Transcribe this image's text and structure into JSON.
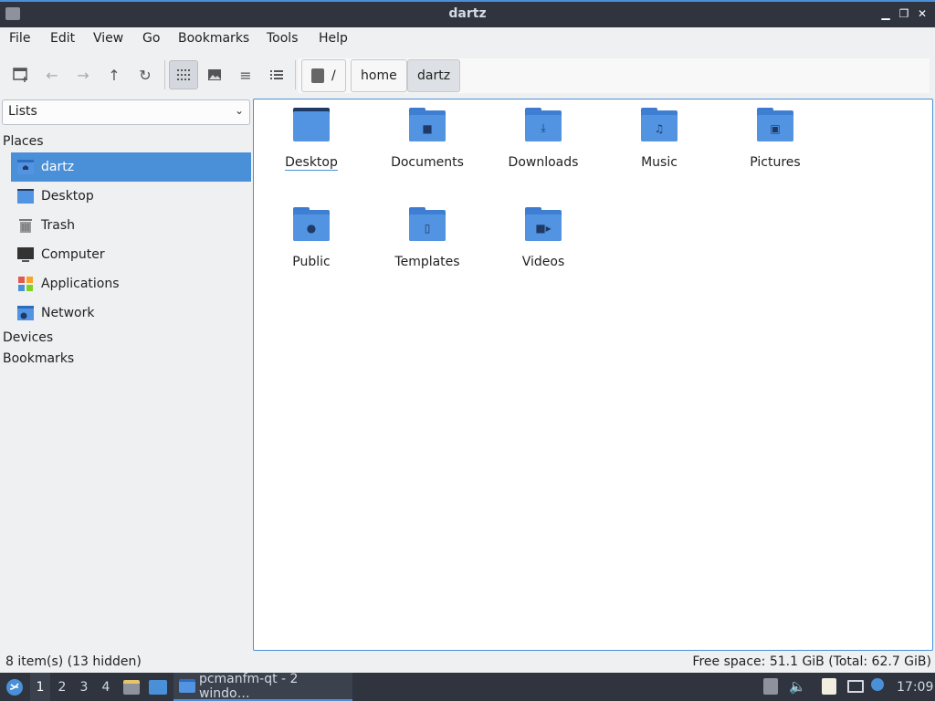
{
  "window": {
    "title": "dartz"
  },
  "menu": [
    "File",
    "Edit",
    "View",
    "Go",
    "Bookmarks",
    "Tools",
    "Help"
  ],
  "breadcrumbs": [
    "/",
    "home",
    "dartz"
  ],
  "side_panel": {
    "selector_value": "Lists",
    "places_heading": "Places",
    "places": [
      {
        "label": "dartz",
        "icon": "home-folder-icon"
      },
      {
        "label": "Desktop",
        "icon": "desktop-folder-icon"
      },
      {
        "label": "Trash",
        "icon": "trash-icon"
      },
      {
        "label": "Computer",
        "icon": "computer-icon"
      },
      {
        "label": "Applications",
        "icon": "applications-icon"
      },
      {
        "label": "Network",
        "icon": "network-icon"
      }
    ],
    "devices_heading": "Devices",
    "bookmarks_heading": "Bookmarks"
  },
  "files": [
    {
      "label": "Desktop",
      "icon": "desktop-folder-icon"
    },
    {
      "label": "Documents",
      "icon": "documents-folder-icon"
    },
    {
      "label": "Downloads",
      "icon": "downloads-folder-icon"
    },
    {
      "label": "Music",
      "icon": "music-folder-icon"
    },
    {
      "label": "Pictures",
      "icon": "pictures-folder-icon"
    },
    {
      "label": "Public",
      "icon": "public-folder-icon"
    },
    {
      "label": "Templates",
      "icon": "templates-folder-icon"
    },
    {
      "label": "Videos",
      "icon": "videos-folder-icon"
    }
  ],
  "status": {
    "left": "8 item(s) (13 hidden)",
    "right": "Free space: 51.1 GiB (Total: 62.7 GiB)"
  },
  "taskbar": {
    "workspaces": [
      "1",
      "2",
      "3",
      "4"
    ],
    "task_label": "pcmanfm-qt - 2 windo…",
    "clock": "17:09"
  },
  "colors": {
    "accent": "#4a90d9",
    "folder": "#5294e2",
    "titlebar": "#2f343f"
  }
}
